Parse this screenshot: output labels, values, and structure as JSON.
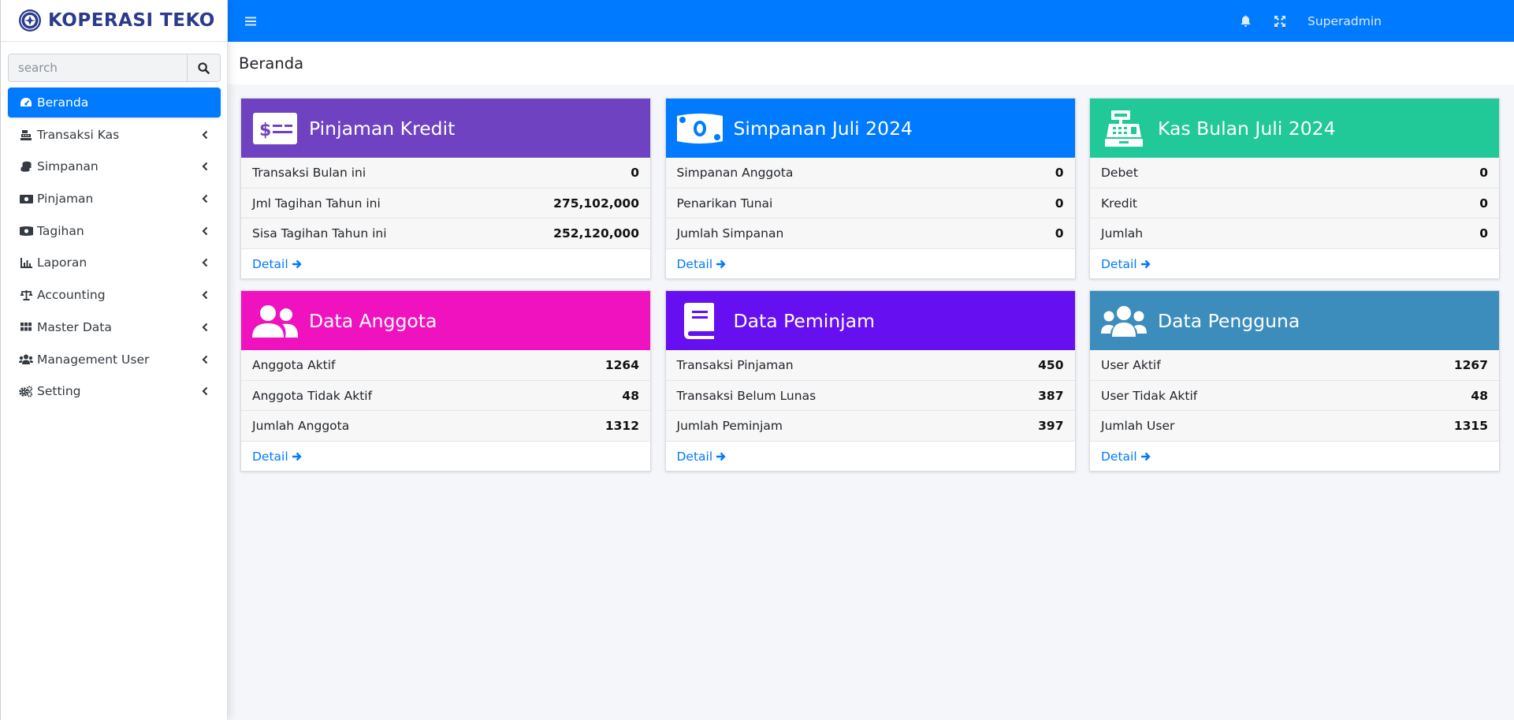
{
  "brand": {
    "name": "KOPERASI TEKO",
    "logo_icon": "cooperative-logo-icon"
  },
  "search": {
    "placeholder": "search"
  },
  "colors": {
    "primary": "#007bff",
    "purple": "#6f42c1",
    "blue": "#007bff",
    "green": "#20c997",
    "pink": "#f012be",
    "violet": "#6610f2",
    "steel": "#3c8dbc"
  },
  "sidebar": {
    "items": [
      {
        "label": "Beranda",
        "icon": "tachometer-icon",
        "active": true
      },
      {
        "label": "Transaksi Kas",
        "icon": "cash-register-icon"
      },
      {
        "label": "Simpanan",
        "icon": "coins-icon"
      },
      {
        "label": "Pinjaman",
        "icon": "money-bill-icon"
      },
      {
        "label": "Tagihan",
        "icon": "money-bill-wave-icon"
      },
      {
        "label": "Laporan",
        "icon": "chart-bar-icon"
      },
      {
        "label": "Accounting",
        "icon": "balance-scale-icon"
      },
      {
        "label": "Master Data",
        "icon": "th-icon"
      },
      {
        "label": "Management User",
        "icon": "users-icon"
      },
      {
        "label": "Setting",
        "icon": "cogs-icon"
      }
    ]
  },
  "topbar": {
    "user": "Superadmin",
    "icons": [
      "hamburger-icon",
      "bell-icon",
      "expand-icon"
    ]
  },
  "page": {
    "title": "Beranda"
  },
  "cards": [
    {
      "title": "Pinjaman Kredit",
      "icon": "money-check-icon",
      "color": "#6f42c1",
      "rows": [
        {
          "label": "Transaksi Bulan ini",
          "value": "0"
        },
        {
          "label": "Jml Tagihan Tahun ini",
          "value": "275,102,000"
        },
        {
          "label": "Sisa Tagihan Tahun ini",
          "value": "252,120,000"
        }
      ],
      "detail": "Detail"
    },
    {
      "title": "Simpanan Juli 2024",
      "icon": "money-bill-icon",
      "color": "#007bff",
      "rows": [
        {
          "label": "Simpanan Anggota",
          "value": "0"
        },
        {
          "label": "Penarikan Tunai",
          "value": "0"
        },
        {
          "label": "Jumlah Simpanan",
          "value": "0"
        }
      ],
      "detail": "Detail"
    },
    {
      "title": "Kas Bulan Juli 2024",
      "icon": "cash-register-icon",
      "color": "#20c997",
      "rows": [
        {
          "label": "Debet",
          "value": "0"
        },
        {
          "label": "Kredit",
          "value": "0"
        },
        {
          "label": "Jumlah",
          "value": "0"
        }
      ],
      "detail": "Detail"
    },
    {
      "title": "Data Anggota",
      "icon": "user-friends-icon",
      "color": "#f012be",
      "rows": [
        {
          "label": "Anggota Aktif",
          "value": "1264"
        },
        {
          "label": "Anggota Tidak Aktif",
          "value": "48"
        },
        {
          "label": "Jumlah Anggota",
          "value": "1312"
        }
      ],
      "detail": "Detail"
    },
    {
      "title": "Data Peminjam",
      "icon": "book-icon",
      "color": "#6610f2",
      "rows": [
        {
          "label": "Transaksi Pinjaman",
          "value": "450"
        },
        {
          "label": "Transaksi Belum Lunas",
          "value": "387"
        },
        {
          "label": "Jumlah Peminjam",
          "value": "397"
        }
      ],
      "detail": "Detail"
    },
    {
      "title": "Data Pengguna",
      "icon": "users-icon",
      "color": "#3c8dbc",
      "rows": [
        {
          "label": "User Aktif",
          "value": "1267"
        },
        {
          "label": "User Tidak Aktif",
          "value": "48"
        },
        {
          "label": "Jumlah User",
          "value": "1315"
        }
      ],
      "detail": "Detail"
    }
  ]
}
